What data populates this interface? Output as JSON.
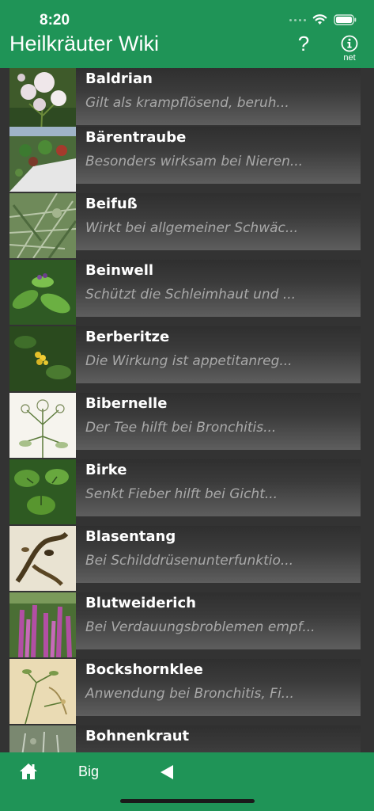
{
  "status_bar": {
    "time": "8:20"
  },
  "header": {
    "title": "Heilkräuter Wiki",
    "help_label": "?",
    "info_label": "net"
  },
  "plants": [
    {
      "name": "Baldrian",
      "description": "Gilt als krampflösend, beruh..."
    },
    {
      "name": "Bärentraube",
      "description": "Besonders wirksam bei Nieren..."
    },
    {
      "name": "Beifuß",
      "description": "Wirkt bei allgemeiner Schwäc..."
    },
    {
      "name": "Beinwell",
      "description": "Schützt die Schleimhaut und ..."
    },
    {
      "name": "Berberitze",
      "description": "Die Wirkung ist appetitanreg..."
    },
    {
      "name": "Bibernelle",
      "description": "Der Tee hilft bei Bronchitis..."
    },
    {
      "name": "Birke",
      "description": "Senkt Fieber hilft bei Gicht..."
    },
    {
      "name": "Blasentang",
      "description": "Bei Schilddrüsenunterfunktio..."
    },
    {
      "name": "Blutweiderich",
      "description": "Bei Verdauungsbroblemen empf..."
    },
    {
      "name": "Bockshornklee",
      "description": "Anwendung bei Bronchitis, Fi..."
    },
    {
      "name": "Bohnenkraut",
      "description": ""
    }
  ],
  "bottom_bar": {
    "home_icon": "home-icon",
    "big_label": "Big",
    "back_icon": "back-triangle-icon"
  },
  "colors": {
    "accent": "#1f9457",
    "list_background": "#333333",
    "description_text": "#a9a9a9"
  }
}
